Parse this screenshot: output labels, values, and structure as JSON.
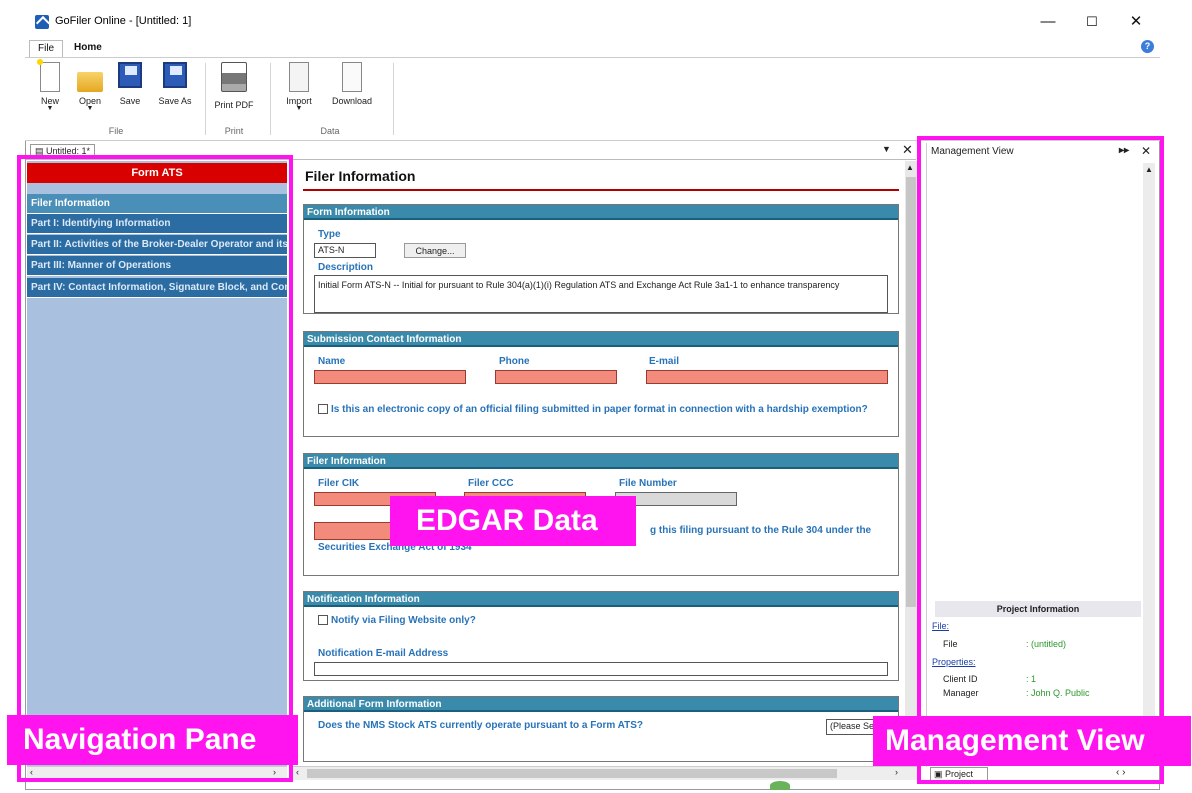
{
  "window": {
    "title": "GoFiler Online - [Untitled: 1]",
    "minimize": "—",
    "maximize": "☐",
    "close": "✕"
  },
  "menu_tabs": [
    {
      "label": "File"
    },
    {
      "label": "Home"
    }
  ],
  "ribbon": {
    "buttons": [
      {
        "label": "New"
      },
      {
        "label": "Open"
      },
      {
        "label": "Save"
      },
      {
        "label": "Save As"
      },
      {
        "label": "Print PDF"
      },
      {
        "label": "Import"
      },
      {
        "label": "Download"
      }
    ],
    "groups": [
      {
        "label": "File"
      },
      {
        "label": "Print"
      },
      {
        "label": "Data"
      }
    ]
  },
  "doc_tab": "Untitled: 1*",
  "nav": {
    "header": "Form ATS",
    "items": [
      {
        "label": "Filer Information"
      },
      {
        "label": "Part I: Identifying Information"
      },
      {
        "label": "Part II: Activities of the Broker-Dealer Operator and its Affiliates"
      },
      {
        "label": "Part III: Manner of Operations"
      },
      {
        "label": "Part IV: Contact Information, Signature Block, and Consent"
      }
    ]
  },
  "form": {
    "title": "Filer Information",
    "form_info": {
      "header": "Form Information",
      "type_label": "Type",
      "type_value": "ATS-N",
      "change_button": "Change...",
      "description_label": "Description",
      "description_value": "Initial Form ATS-N -- Initial for pursuant to Rule 304(a)(1)(i) Regulation ATS and Exchange Act Rule 3a1-1 to enhance transparency"
    },
    "contact": {
      "header": "Submission Contact Information",
      "name_label": "Name",
      "phone_label": "Phone",
      "email_label": "E-mail",
      "hardship_q": "Is this an electronic copy of an official filing submitted in paper format in connection with a hardship exemption?"
    },
    "filer": {
      "header": "Filer Information",
      "cik_label": "Filer CIK",
      "ccc_label": "Filer CCC",
      "file_number_label": "File Number",
      "question_end": "g this filing pursuant to the Rule 304 under the",
      "question_line2": "Securities Exchange Act of 1934"
    },
    "notification": {
      "header": "Notification Information",
      "website_only": "Notify via Filing Website only?",
      "email_label": "Notification E-mail Address"
    },
    "additional": {
      "header": "Additional Form Information",
      "question": "Does the NMS Stock ATS currently operate pursuant to a Form ATS?",
      "select_placeholder": "(Please Se"
    }
  },
  "management": {
    "title": "Management View",
    "project_info_header": "Project Information",
    "file_link": "File:",
    "file_key": "File",
    "file_value": ": (untitled)",
    "properties_link": "Properties:",
    "client_key": "Client ID",
    "client_value": ": 1",
    "manager_key": "Manager",
    "manager_value": ": John Q. Public",
    "project_tab": "Project"
  },
  "overlays": {
    "navigation_pane": "Navigation Pane",
    "edgar_data": "EDGAR Data",
    "management_view": "Management View"
  },
  "colors": {
    "overlay": "#ff14f0",
    "nav_header": "#d90000",
    "section_header": "#3a8bab",
    "required_field": "#f38b7c"
  }
}
